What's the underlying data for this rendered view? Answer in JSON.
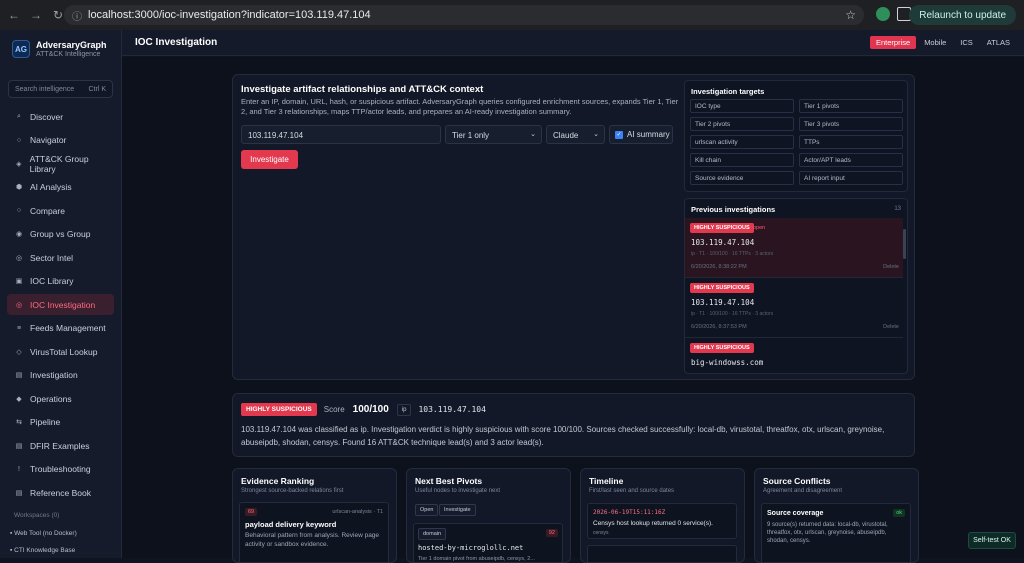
{
  "browser": {
    "url": "localhost:3000/ioc-investigation?indicator=103.119.47.104",
    "relaunch_label": "Relaunch to update"
  },
  "brand": {
    "title": "AdversaryGraph",
    "subtitle": "ATT&CK Intelligence",
    "logo_text": "AG"
  },
  "sidebar": {
    "search_placeholder": "Search intelligence",
    "search_shortcut": "Ctrl K",
    "items": [
      {
        "label": "Discover",
        "icon": "search-icon",
        "glyph": "⌕"
      },
      {
        "label": "Navigator",
        "icon": "compass-icon",
        "glyph": "○"
      },
      {
        "label": "ATT&CK Group Library",
        "icon": "diamond-icon",
        "glyph": "◈"
      },
      {
        "label": "AI Analysis",
        "icon": "hexagon-icon",
        "glyph": "⬢"
      },
      {
        "label": "Compare",
        "icon": "circle-icon",
        "glyph": "○"
      },
      {
        "label": "Group vs Group",
        "icon": "target-icon",
        "glyph": "◉"
      },
      {
        "label": "Sector Intel",
        "icon": "target-icon",
        "glyph": "◎"
      },
      {
        "label": "IOC Library",
        "icon": "square-icon",
        "glyph": "▣"
      },
      {
        "label": "IOC Investigation",
        "icon": "radar-icon",
        "glyph": "◎",
        "active": true
      },
      {
        "label": "Feeds Management",
        "icon": "lines-icon",
        "glyph": "≡"
      },
      {
        "label": "VirusTotal Lookup",
        "icon": "diamond-outline-icon",
        "glyph": "◇"
      },
      {
        "label": "Investigation",
        "icon": "file-icon",
        "glyph": "▤"
      },
      {
        "label": "Operations",
        "icon": "diamond-filled-icon",
        "glyph": "◆"
      },
      {
        "label": "Pipeline",
        "icon": "pipeline-icon",
        "glyph": "⇆"
      },
      {
        "label": "DFIR Examples",
        "icon": "file-icon",
        "glyph": "▤"
      },
      {
        "label": "Troubleshooting",
        "icon": "alert-icon",
        "glyph": "!"
      },
      {
        "label": "Reference Book",
        "icon": "book-icon",
        "glyph": "▤"
      }
    ],
    "workspaces_label": "Workspaces (0)",
    "workspace_items": [
      "Web Tool (no Docker)",
      "CTI Knowledge Base"
    ]
  },
  "topbar": {
    "title": "IOC Investigation",
    "tabs": [
      {
        "label": "Enterprise",
        "active": true
      },
      {
        "label": "Mobile"
      },
      {
        "label": "ICS"
      },
      {
        "label": "ATLAS"
      }
    ]
  },
  "investigate": {
    "heading": "Investigate artifact relationships and ATT&CK context",
    "description": "Enter an IP, domain, URL, hash, or suspicious artifact. AdversaryGraph queries configured enrichment sources, expands Tier 1, Tier 2, and Tier 3 relationships, maps TTP/actor leads, and prepares an AI-ready investigation summary.",
    "indicator_value": "103.119.47.104",
    "tier_select": "Tier 1 only",
    "model_select": "Claude",
    "ai_summary_label": "AI summary",
    "ai_summary_checked": true,
    "button_label": "Investigate"
  },
  "targets": {
    "heading": "Investigation targets",
    "items": [
      "IOC type",
      "Tier 1 pivots",
      "Tier 2 pivots",
      "Tier 3 pivots",
      "urlscan activity",
      "TTPs",
      "Kill chain",
      "Actor/APT leads",
      "Source evidence",
      "AI report input"
    ]
  },
  "previous": {
    "heading": "Previous investigations",
    "count": "13",
    "items": [
      {
        "badge": "HIGHLY SUSPICIOUS",
        "status": "open",
        "indicator": "103.119.47.104",
        "meta": "ip · T1 · 100/100 · 16 TTPs · 3 actors",
        "date": "6/20/2026, 8:38:22 PM",
        "delete": "Delete",
        "selected": true
      },
      {
        "badge": "HIGHLY SUSPICIOUS",
        "status": "",
        "indicator": "103.119.47.104",
        "meta": "ip · T1 · 100/100 · 16 TTPs · 3 actors",
        "date": "6/20/2026, 8:37:53 PM",
        "delete": "Delete",
        "selected": false
      },
      {
        "badge": "HIGHLY SUSPICIOUS",
        "status": "",
        "indicator": "big-windowss.com",
        "meta": "",
        "date": "",
        "delete": "",
        "selected": false
      }
    ]
  },
  "verdict": {
    "badge": "HIGHLY SUSPICIOUS",
    "score_label": "Score",
    "score": "100/100",
    "type": "ip",
    "indicator": "103.119.47.104",
    "summary": "103.119.47.104 was classified as ip. Investigation verdict is highly suspicious with score 100/100. Sources checked successfully: local-db, virustotal, threatfox, otx, urlscan, greynoise, abuseipdb, shodan, censys. Found 16 ATT&CK technique lead(s) and 3 actor lead(s)."
  },
  "columns": {
    "evidence": {
      "title": "Evidence Ranking",
      "subtitle": "Strongest source-backed relations first",
      "item": {
        "rank": "69",
        "source": "urlscan-analysis · T1",
        "title": "payload delivery keyword",
        "body": "Behavioral pattern from analysis. Review page activity or sandbox evidence."
      }
    },
    "pivots": {
      "title": "Next Best Pivots",
      "subtitle": "Useful nodes to investigate next",
      "open_label": "Open",
      "investigate_label": "Investigate",
      "item": {
        "tag": "domain",
        "score": "92",
        "value": "hosted-by-microglollc.net",
        "body": "Tier 1 domain pivot from abuseipdb, censys, 2..."
      }
    },
    "timeline": {
      "title": "Timeline",
      "subtitle": "First/last seen and source dates",
      "item": {
        "time": "2026-06-19T15:11:16Z",
        "text": "Censys host lookup returned 0 service(s).",
        "source": "censys"
      }
    },
    "conflicts": {
      "title": "Source Conflicts",
      "subtitle": "Agreement and disagreement",
      "item": {
        "title": "Source coverage",
        "status": "ok",
        "body": "9 source(s) returned data: local-db, virustotal, threatfox, otx, urlscan, greynoise, abuseipdb, shodan, censys."
      }
    }
  },
  "selftest_label": "Self-test OK"
}
